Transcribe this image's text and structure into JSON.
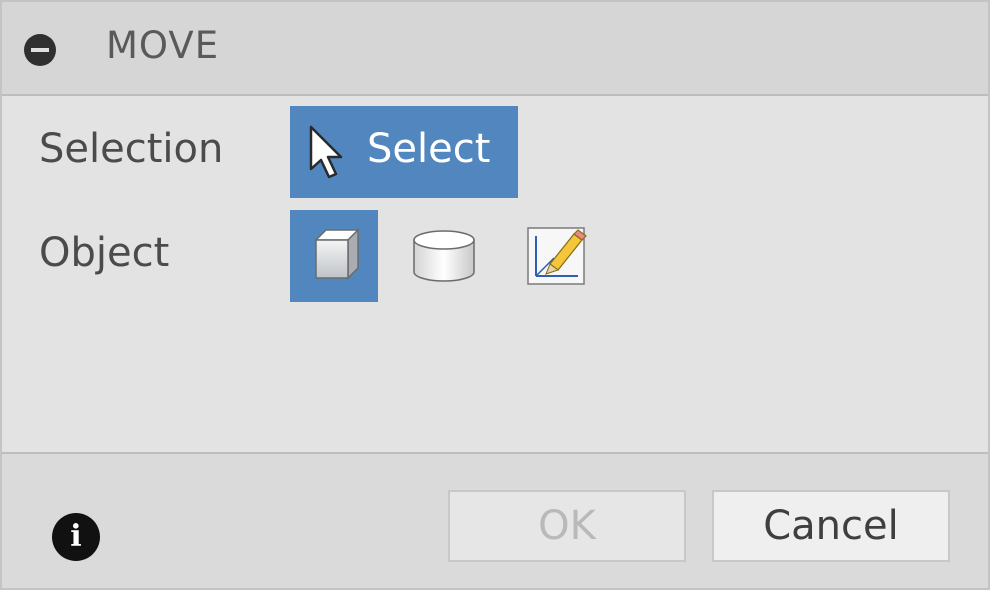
{
  "dialog": {
    "title": "MOVE",
    "collapse_icon": "minus-circle-icon"
  },
  "rows": {
    "selection": {
      "label": "Selection",
      "button_label": "Select",
      "button_icon": "cursor-arrow-icon"
    },
    "object": {
      "label": "Object",
      "options": [
        {
          "icon": "body-cube-icon",
          "selected": true
        },
        {
          "icon": "component-cylinder-icon",
          "selected": false
        },
        {
          "icon": "sketch-pencil-icon",
          "selected": false
        }
      ]
    }
  },
  "footer": {
    "info_icon": "info-icon",
    "info_glyph": "i",
    "ok_label": "OK",
    "ok_enabled": false,
    "cancel_label": "Cancel"
  },
  "colors": {
    "accent": "#5286bf",
    "header_bg": "#d6d6d6",
    "body_bg": "#e3e3e3"
  }
}
